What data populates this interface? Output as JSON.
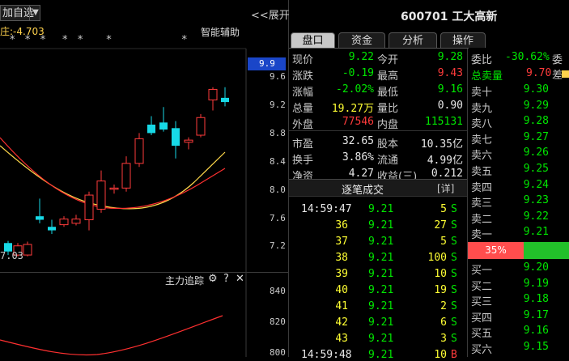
{
  "left": {
    "selector_text": "加自选",
    "expand_label": "<<展开",
    "indicator_label": "庄:-4.703",
    "smart_aid_label": "智能辅助",
    "marks": "*   *   *     *   *       *                     *",
    "low_price_label": "7.03",
    "price_axis": [
      "9.6",
      "9.2",
      "8.8",
      "8.4",
      "8.0",
      "7.6",
      "7.2"
    ],
    "current_axis_price": "9.9",
    "subchart": {
      "title": "主力追踪",
      "gear_icon": "⚙",
      "help_icon": "?",
      "close_icon": "✕",
      "axis": [
        "840",
        "820",
        "800"
      ]
    }
  },
  "header": {
    "code": "600701",
    "name": "工大高新"
  },
  "tabs": [
    "盘口",
    "资金",
    "分析",
    "操作"
  ],
  "quote": {
    "rows": [
      {
        "l1": "现价",
        "v1": "9.22",
        "c1": "green",
        "l2": "今开",
        "v2": "9.28",
        "c2": "green"
      },
      {
        "l1": "涨跌",
        "v1": "-0.19",
        "c1": "green",
        "l2": "最高",
        "v2": "9.43",
        "c2": "red"
      },
      {
        "l1": "涨幅",
        "v1": "-2.02%",
        "c1": "green",
        "l2": "最低",
        "v2": "9.16",
        "c2": "green"
      },
      {
        "l1": "总量",
        "v1": "19.27万",
        "c1": "yellow",
        "l2": "量比",
        "v2": "0.90",
        "c2": "white"
      },
      {
        "l1": "外盘",
        "v1": "77546",
        "c1": "red",
        "l2": "内盘",
        "v2": "115131",
        "c2": "green"
      },
      {
        "l1": "市盈",
        "v1": "32.65",
        "c1": "white",
        "l2": "股本",
        "v2": "10.35亿",
        "c2": "white"
      },
      {
        "l1": "换手",
        "v1": "3.86%",
        "c1": "white",
        "l2": "流通",
        "v2": "4.99亿",
        "c2": "white"
      },
      {
        "l1": "净资",
        "v1": "4.27",
        "c1": "white",
        "l2": "收益(三)",
        "v2": "0.212",
        "c2": "white"
      }
    ]
  },
  "trades": {
    "title": "逐笔成交",
    "detail_label": "[详]",
    "rows": [
      {
        "time": "14:59:47",
        "price": "9.21",
        "vol": "5",
        "side": "S"
      },
      {
        "time": "36",
        "price": "9.21",
        "vol": "27",
        "side": "S"
      },
      {
        "time": "37",
        "price": "9.21",
        "vol": "5",
        "side": "S"
      },
      {
        "time": "38",
        "price": "9.21",
        "vol": "100",
        "side": "S"
      },
      {
        "time": "39",
        "price": "9.21",
        "vol": "10",
        "side": "S"
      },
      {
        "time": "40",
        "price": "9.21",
        "vol": "19",
        "side": "S"
      },
      {
        "time": "41",
        "price": "9.21",
        "vol": "2",
        "side": "S"
      },
      {
        "time": "42",
        "price": "9.21",
        "vol": "6",
        "side": "S"
      },
      {
        "time": "43",
        "price": "9.21",
        "vol": "3",
        "side": "S"
      },
      {
        "time": "14:59:48",
        "price": "9.21",
        "vol": "10",
        "side": "B"
      }
    ]
  },
  "orderbook": {
    "weibi_label": "委比",
    "weibi_value": "-30.62%",
    "weicha_label": "委差",
    "total_label": "总卖量",
    "total_price": "9.70",
    "asks": [
      {
        "label": "卖十",
        "price": "9.30"
      },
      {
        "label": "卖九",
        "price": "9.29"
      },
      {
        "label": "卖八",
        "price": "9.28"
      },
      {
        "label": "卖七",
        "price": "9.27"
      },
      {
        "label": "卖六",
        "price": "9.26"
      },
      {
        "label": "卖五",
        "price": "9.25"
      },
      {
        "label": "卖四",
        "price": "9.24"
      },
      {
        "label": "卖三",
        "price": "9.23"
      },
      {
        "label": "卖二",
        "price": "9.22"
      },
      {
        "label": "卖一",
        "price": "9.21"
      }
    ],
    "ratio_text": "35%",
    "bids": [
      {
        "label": "买一",
        "price": "9.20"
      },
      {
        "label": "买二",
        "price": "9.19"
      },
      {
        "label": "买三",
        "price": "9.18"
      },
      {
        "label": "买四",
        "price": "9.17"
      },
      {
        "label": "买五",
        "price": "9.16"
      },
      {
        "label": "买六",
        "price": "9.15"
      }
    ]
  },
  "candles": [
    {
      "o": 7.22,
      "c": 7.1,
      "h": 7.25,
      "l": 7.05
    },
    {
      "o": 7.05,
      "c": 7.18,
      "h": 7.22,
      "l": 7.03
    },
    {
      "o": 7.05,
      "c": 7.2,
      "h": 7.24,
      "l": 7.03
    },
    {
      "o": 7.6,
      "c": 7.55,
      "h": 7.85,
      "l": 7.5
    },
    {
      "o": 7.45,
      "c": 7.4,
      "h": 7.55,
      "l": 7.35
    },
    {
      "o": 7.48,
      "c": 7.56,
      "h": 7.6,
      "l": 7.45
    },
    {
      "o": 7.5,
      "c": 7.56,
      "h": 7.62,
      "l": 7.47
    },
    {
      "o": 7.55,
      "c": 7.9,
      "h": 7.95,
      "l": 7.4
    },
    {
      "o": 7.7,
      "c": 8.1,
      "h": 8.25,
      "l": 7.65
    },
    {
      "o": 8.0,
      "c": 8.0,
      "h": 8.05,
      "l": 7.92
    },
    {
      "o": 8.0,
      "c": 8.35,
      "h": 8.45,
      "l": 7.95
    },
    {
      "o": 8.35,
      "c": 8.7,
      "h": 8.78,
      "l": 8.3
    },
    {
      "o": 8.9,
      "c": 8.78,
      "h": 9.02,
      "l": 8.75
    },
    {
      "o": 8.93,
      "c": 8.83,
      "h": 9.15,
      "l": 8.8
    },
    {
      "o": 8.85,
      "c": 8.6,
      "h": 8.95,
      "l": 8.42
    },
    {
      "o": 8.65,
      "c": 8.68,
      "h": 8.72,
      "l": 8.55
    },
    {
      "o": 8.75,
      "c": 9.0,
      "h": 9.05,
      "l": 8.72
    },
    {
      "o": 9.25,
      "c": 9.4,
      "h": 9.43,
      "l": 9.1
    },
    {
      "o": 9.28,
      "c": 9.22,
      "h": 9.43,
      "l": 9.16
    }
  ]
}
